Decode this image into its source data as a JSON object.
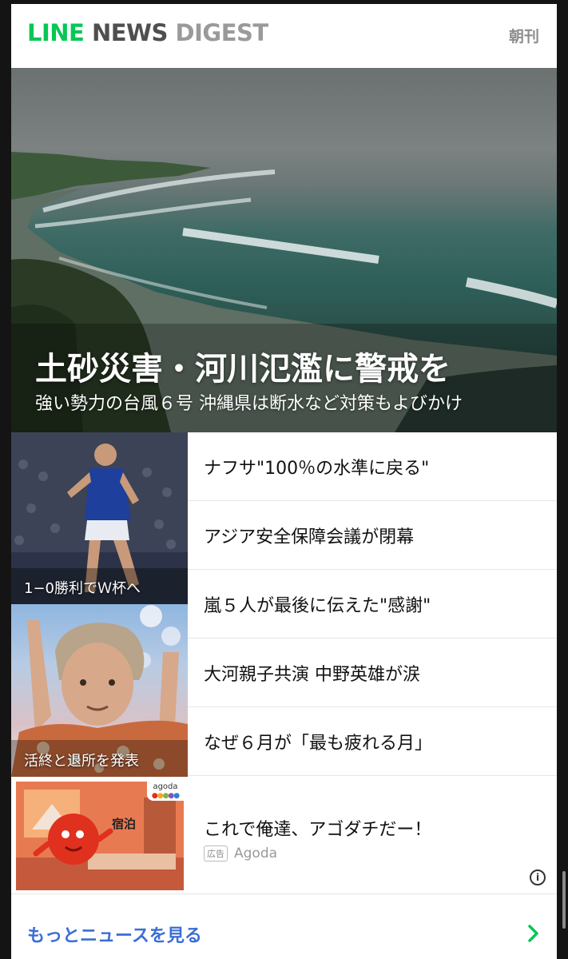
{
  "header": {
    "logo_line": "LINE",
    "logo_news": "NEWS",
    "logo_digest": "DIGEST",
    "edition": "朝刊"
  },
  "hero": {
    "title": "土砂災害・河川氾濫に警戒を",
    "subtitle": "強い勢力の台風６号 沖縄県は断水など対策もよびかけ"
  },
  "photos": [
    {
      "caption": "1−0勝利でＷ杯へ"
    },
    {
      "caption": "活終と退所を発表"
    }
  ],
  "headlines": [
    "ナフサ\"100％の水準に戻る\"",
    "アジア安全保障会議が閉幕",
    "嵐５人が最後に伝えた\"感謝\"",
    "大河親子共演 中野英雄が涙",
    "なぜ６月が「最も疲れる月」"
  ],
  "ad": {
    "title": "これで俺達、アゴダチだー！",
    "label": "広告",
    "sponsor": "Agoda",
    "badge": "agoda",
    "image_text": "宿泊"
  },
  "more": {
    "label": "もっとニュースを見る"
  },
  "colors": {
    "brand_green": "#06c755",
    "link_blue": "#3b6ed4",
    "arrow_green": "#06c755"
  }
}
